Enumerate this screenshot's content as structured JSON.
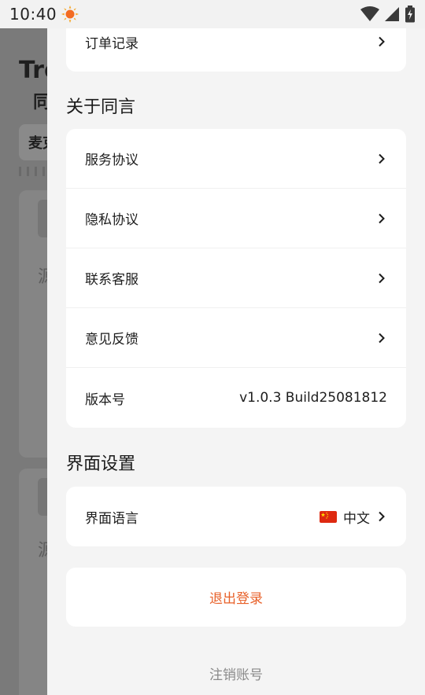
{
  "status_bar": {
    "time": "10:40"
  },
  "background_app": {
    "title": "Tro",
    "subtitle": "同",
    "search_label": "麦克",
    "card_text_1": "源",
    "card_text_2": "源"
  },
  "drawer": {
    "top_card": {
      "order_history": "订单记录"
    },
    "about_section": {
      "title": "关于同言",
      "items": [
        {
          "label": "服务协议"
        },
        {
          "label": "隐私协议"
        },
        {
          "label": "联系客服"
        },
        {
          "label": "意见反馈"
        }
      ],
      "version_label": "版本号",
      "version_value": "v1.0.3 Build25081812"
    },
    "interface_section": {
      "title": "界面设置",
      "language_label": "界面语言",
      "language_value": "中文"
    },
    "logout_label": "退出登录",
    "cancel_account_label": "注销账号"
  },
  "colors": {
    "accent": "#e8612a",
    "muted": "#8a8a8a"
  }
}
